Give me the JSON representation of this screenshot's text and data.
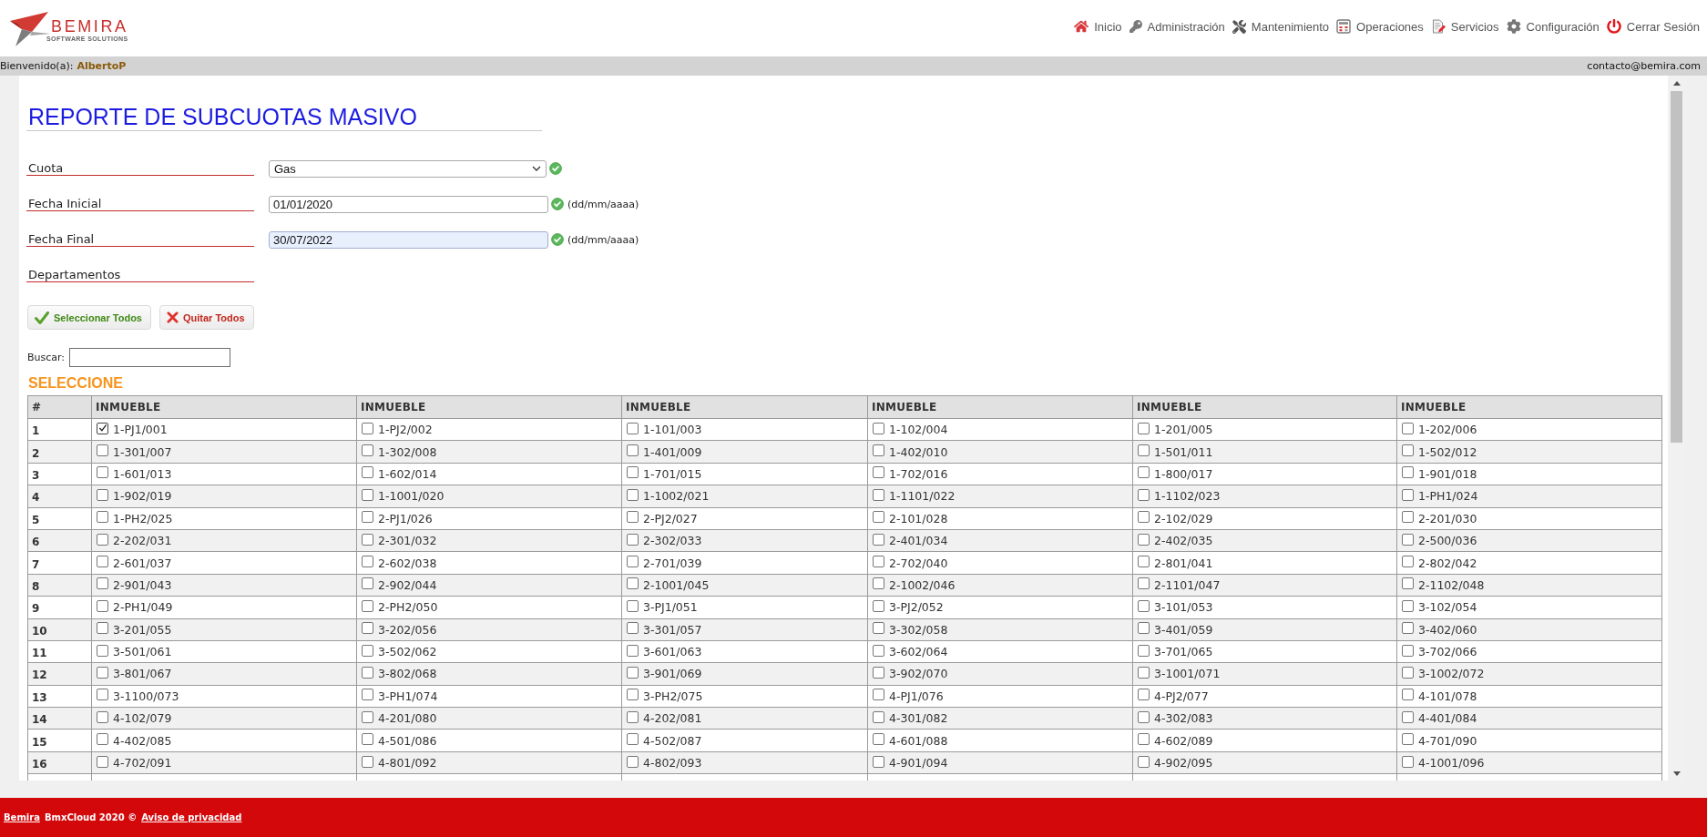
{
  "header": {
    "logo": {
      "name": "BEMIRA",
      "tagline": "SOFTWARE SOLUTIONS"
    },
    "nav": [
      {
        "label": "Inicio"
      },
      {
        "label": "Administración"
      },
      {
        "label": "Mantenimiento"
      },
      {
        "label": "Operaciones"
      },
      {
        "label": "Servicios"
      },
      {
        "label": "Configuración"
      },
      {
        "label": "Cerrar Sesión"
      }
    ]
  },
  "info_bar": {
    "greeting": "Bienvenido(a):",
    "user": "AlbertoP",
    "email": "contacto@bemira.com"
  },
  "report": {
    "title": "REPORTE DE SUBCUOTAS MASIVO",
    "fields": [
      {
        "kind": "select",
        "label": "Cuota",
        "value": "Gas",
        "valid": true
      },
      {
        "kind": "date",
        "label": "Fecha Inicial",
        "value": "01/01/2020",
        "valid": true,
        "format_hint": "(dd/mm/aaaa)",
        "autofilled": false
      },
      {
        "kind": "date",
        "label": "Fecha Final",
        "value": "30/07/2022",
        "valid": true,
        "format_hint": "(dd/mm/aaaa)",
        "autofilled": true
      },
      {
        "kind": "heading",
        "label": "Departamentos"
      }
    ],
    "buttons": [
      {
        "kind": "select_all",
        "label": "Seleccionar Todos"
      },
      {
        "kind": "clear_all",
        "label": "Quitar Todos"
      }
    ],
    "search": {
      "label": "Buscar:"
    },
    "section_title": "SELECCIONE",
    "table": {
      "columns": [
        "#",
        "INMUEBLE",
        "INMUEBLE",
        "INMUEBLE",
        "INMUEBLE",
        "INMUEBLE",
        "INMUEBLE"
      ],
      "rows": [
        {
          "cells": [
            {
              "kind": "number",
              "text": "1"
            },
            {
              "kind": "unit",
              "label": "1-PJ1/001",
              "checked": true
            },
            {
              "kind": "unit",
              "label": "1-PJ2/002",
              "checked": false
            },
            {
              "kind": "unit",
              "label": "1-101/003",
              "checked": false
            },
            {
              "kind": "unit",
              "label": "1-102/004",
              "checked": false
            },
            {
              "kind": "unit",
              "label": "1-201/005",
              "checked": false
            },
            {
              "kind": "unit",
              "label": "1-202/006",
              "checked": false
            }
          ]
        },
        {
          "cells": [
            {
              "kind": "number",
              "text": "2"
            },
            {
              "kind": "unit",
              "label": "1-301/007",
              "checked": false
            },
            {
              "kind": "unit",
              "label": "1-302/008",
              "checked": false
            },
            {
              "kind": "unit",
              "label": "1-401/009",
              "checked": false
            },
            {
              "kind": "unit",
              "label": "1-402/010",
              "checked": false
            },
            {
              "kind": "unit",
              "label": "1-501/011",
              "checked": false
            },
            {
              "kind": "unit",
              "label": "1-502/012",
              "checked": false
            }
          ]
        },
        {
          "cells": [
            {
              "kind": "number",
              "text": "3"
            },
            {
              "kind": "unit",
              "label": "1-601/013",
              "checked": false
            },
            {
              "kind": "unit",
              "label": "1-602/014",
              "checked": false
            },
            {
              "kind": "unit",
              "label": "1-701/015",
              "checked": false
            },
            {
              "kind": "unit",
              "label": "1-702/016",
              "checked": false
            },
            {
              "kind": "unit",
              "label": "1-800/017",
              "checked": false
            },
            {
              "kind": "unit",
              "label": "1-901/018",
              "checked": false
            }
          ]
        },
        {
          "cells": [
            {
              "kind": "number",
              "text": "4"
            },
            {
              "kind": "unit",
              "label": "1-902/019",
              "checked": false
            },
            {
              "kind": "unit",
              "label": "1-1001/020",
              "checked": false
            },
            {
              "kind": "unit",
              "label": "1-1002/021",
              "checked": false
            },
            {
              "kind": "unit",
              "label": "1-1101/022",
              "checked": false
            },
            {
              "kind": "unit",
              "label": "1-1102/023",
              "checked": false
            },
            {
              "kind": "unit",
              "label": "1-PH1/024",
              "checked": false
            }
          ]
        },
        {
          "cells": [
            {
              "kind": "number",
              "text": "5"
            },
            {
              "kind": "unit",
              "label": "1-PH2/025",
              "checked": false
            },
            {
              "kind": "unit",
              "label": "2-PJ1/026",
              "checked": false
            },
            {
              "kind": "unit",
              "label": "2-PJ2/027",
              "checked": false
            },
            {
              "kind": "unit",
              "label": "2-101/028",
              "checked": false
            },
            {
              "kind": "unit",
              "label": "2-102/029",
              "checked": false
            },
            {
              "kind": "unit",
              "label": "2-201/030",
              "checked": false
            }
          ]
        },
        {
          "cells": [
            {
              "kind": "number",
              "text": "6"
            },
            {
              "kind": "unit",
              "label": "2-202/031",
              "checked": false
            },
            {
              "kind": "unit",
              "label": "2-301/032",
              "checked": false
            },
            {
              "kind": "unit",
              "label": "2-302/033",
              "checked": false
            },
            {
              "kind": "unit",
              "label": "2-401/034",
              "checked": false
            },
            {
              "kind": "unit",
              "label": "2-402/035",
              "checked": false
            },
            {
              "kind": "unit",
              "label": "2-500/036",
              "checked": false
            }
          ]
        },
        {
          "cells": [
            {
              "kind": "number",
              "text": "7"
            },
            {
              "kind": "unit",
              "label": "2-601/037",
              "checked": false
            },
            {
              "kind": "unit",
              "label": "2-602/038",
              "checked": false
            },
            {
              "kind": "unit",
              "label": "2-701/039",
              "checked": false
            },
            {
              "kind": "unit",
              "label": "2-702/040",
              "checked": false
            },
            {
              "kind": "unit",
              "label": "2-801/041",
              "checked": false
            },
            {
              "kind": "unit",
              "label": "2-802/042",
              "checked": false
            }
          ]
        },
        {
          "cells": [
            {
              "kind": "number",
              "text": "8"
            },
            {
              "kind": "unit",
              "label": "2-901/043",
              "checked": false
            },
            {
              "kind": "unit",
              "label": "2-902/044",
              "checked": false
            },
            {
              "kind": "unit",
              "label": "2-1001/045",
              "checked": false
            },
            {
              "kind": "unit",
              "label": "2-1002/046",
              "checked": false
            },
            {
              "kind": "unit",
              "label": "2-1101/047",
              "checked": false
            },
            {
              "kind": "unit",
              "label": "2-1102/048",
              "checked": false
            }
          ]
        },
        {
          "cells": [
            {
              "kind": "number",
              "text": "9"
            },
            {
              "kind": "unit",
              "label": "2-PH1/049",
              "checked": false
            },
            {
              "kind": "unit",
              "label": "2-PH2/050",
              "checked": false
            },
            {
              "kind": "unit",
              "label": "3-PJ1/051",
              "checked": false
            },
            {
              "kind": "unit",
              "label": "3-PJ2/052",
              "checked": false
            },
            {
              "kind": "unit",
              "label": "3-101/053",
              "checked": false
            },
            {
              "kind": "unit",
              "label": "3-102/054",
              "checked": false
            }
          ]
        },
        {
          "cells": [
            {
              "kind": "number",
              "text": "10"
            },
            {
              "kind": "unit",
              "label": "3-201/055",
              "checked": false
            },
            {
              "kind": "unit",
              "label": "3-202/056",
              "checked": false
            },
            {
              "kind": "unit",
              "label": "3-301/057",
              "checked": false
            },
            {
              "kind": "unit",
              "label": "3-302/058",
              "checked": false
            },
            {
              "kind": "unit",
              "label": "3-401/059",
              "checked": false
            },
            {
              "kind": "unit",
              "label": "3-402/060",
              "checked": false
            }
          ]
        },
        {
          "cells": [
            {
              "kind": "number",
              "text": "11"
            },
            {
              "kind": "unit",
              "label": "3-501/061",
              "checked": false
            },
            {
              "kind": "unit",
              "label": "3-502/062",
              "checked": false
            },
            {
              "kind": "unit",
              "label": "3-601/063",
              "checked": false
            },
            {
              "kind": "unit",
              "label": "3-602/064",
              "checked": false
            },
            {
              "kind": "unit",
              "label": "3-701/065",
              "checked": false
            },
            {
              "kind": "unit",
              "label": "3-702/066",
              "checked": false
            }
          ]
        },
        {
          "cells": [
            {
              "kind": "number",
              "text": "12"
            },
            {
              "kind": "unit",
              "label": "3-801/067",
              "checked": false
            },
            {
              "kind": "unit",
              "label": "3-802/068",
              "checked": false
            },
            {
              "kind": "unit",
              "label": "3-901/069",
              "checked": false
            },
            {
              "kind": "unit",
              "label": "3-902/070",
              "checked": false
            },
            {
              "kind": "unit",
              "label": "3-1001/071",
              "checked": false
            },
            {
              "kind": "unit",
              "label": "3-1002/072",
              "checked": false
            }
          ]
        },
        {
          "cells": [
            {
              "kind": "number",
              "text": "13"
            },
            {
              "kind": "unit",
              "label": "3-1100/073",
              "checked": false
            },
            {
              "kind": "unit",
              "label": "3-PH1/074",
              "checked": false
            },
            {
              "kind": "unit",
              "label": "3-PH2/075",
              "checked": false
            },
            {
              "kind": "unit",
              "label": "4-PJ1/076",
              "checked": false
            },
            {
              "kind": "unit",
              "label": "4-PJ2/077",
              "checked": false
            },
            {
              "kind": "unit",
              "label": "4-101/078",
              "checked": false
            }
          ]
        },
        {
          "cells": [
            {
              "kind": "number",
              "text": "14"
            },
            {
              "kind": "unit",
              "label": "4-102/079",
              "checked": false
            },
            {
              "kind": "unit",
              "label": "4-201/080",
              "checked": false
            },
            {
              "kind": "unit",
              "label": "4-202/081",
              "checked": false
            },
            {
              "kind": "unit",
              "label": "4-301/082",
              "checked": false
            },
            {
              "kind": "unit",
              "label": "4-302/083",
              "checked": false
            },
            {
              "kind": "unit",
              "label": "4-401/084",
              "checked": false
            }
          ]
        },
        {
          "cells": [
            {
              "kind": "number",
              "text": "15"
            },
            {
              "kind": "unit",
              "label": "4-402/085",
              "checked": false
            },
            {
              "kind": "unit",
              "label": "4-501/086",
              "checked": false
            },
            {
              "kind": "unit",
              "label": "4-502/087",
              "checked": false
            },
            {
              "kind": "unit",
              "label": "4-601/088",
              "checked": false
            },
            {
              "kind": "unit",
              "label": "4-602/089",
              "checked": false
            },
            {
              "kind": "unit",
              "label": "4-701/090",
              "checked": false
            }
          ]
        },
        {
          "cells": [
            {
              "kind": "number",
              "text": "16"
            },
            {
              "kind": "unit",
              "label": "4-702/091",
              "checked": false
            },
            {
              "kind": "unit",
              "label": "4-801/092",
              "checked": false
            },
            {
              "kind": "unit",
              "label": "4-802/093",
              "checked": false
            },
            {
              "kind": "unit",
              "label": "4-901/094",
              "checked": false
            },
            {
              "kind": "unit",
              "label": "4-902/095",
              "checked": false
            },
            {
              "kind": "unit",
              "label": "4-1001/096",
              "checked": false
            }
          ]
        }
      ]
    }
  },
  "footer": {
    "brand_link": "Bemira",
    "text": "BmxCloud 2020 ©",
    "privacy_link": "Aviso de privacidad"
  }
}
